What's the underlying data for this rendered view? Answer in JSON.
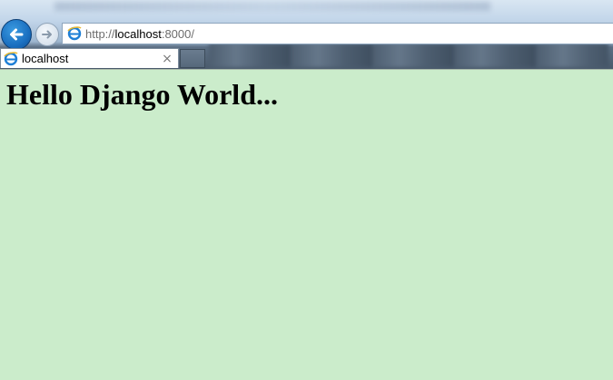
{
  "browser": {
    "address": {
      "prefix": "http://",
      "host": "localhost",
      "suffix": ":8000/"
    },
    "tab": {
      "title": "localhost",
      "close_glyph": "×"
    },
    "icons": {
      "back": "back-arrow-icon",
      "forward": "forward-arrow-icon",
      "page": "internet-explorer-icon",
      "close": "close-icon"
    },
    "colors": {
      "back_button": "#1a6fc0",
      "page_background": "#cbeccb"
    }
  },
  "page": {
    "heading": "Hello Django World..."
  }
}
